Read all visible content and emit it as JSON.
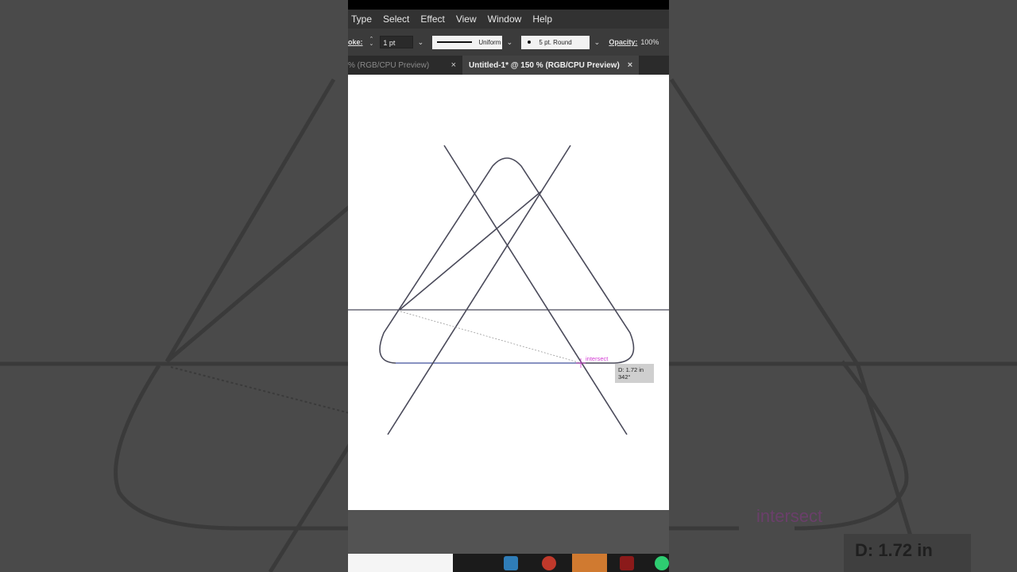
{
  "menu": {
    "items": [
      "Type",
      "Select",
      "Effect",
      "View",
      "Window",
      "Help"
    ]
  },
  "controlbar": {
    "stroke_label": "oke:",
    "stroke_weight": "1 pt",
    "variable_width_profile": "Uniform",
    "brush_definition": "5 pt. Round",
    "opacity_label": "Opacity:",
    "opacity_value": "100%"
  },
  "tabs": [
    {
      "label": "% (RGB/CPU Preview)",
      "active": false
    },
    {
      "label": "Untitled-1* @ 150 % (RGB/CPU Preview)",
      "active": true
    }
  ],
  "icons": {
    "tab_close": "×",
    "dropdown": "⌄",
    "stepper_up": "⌃",
    "stepper_down": "⌄"
  },
  "smart_guide": {
    "hint": "intersect",
    "measure_distance": "D: 1.72 in",
    "measure_angle": "342°"
  },
  "background_overlay": {
    "measure_distance": "D: 1.72 in",
    "hint": "intersect"
  },
  "colors": {
    "stroke": "#4a4a5a",
    "guide_pink": "#d33ad3",
    "selection_blue": "#6b7fd6"
  }
}
